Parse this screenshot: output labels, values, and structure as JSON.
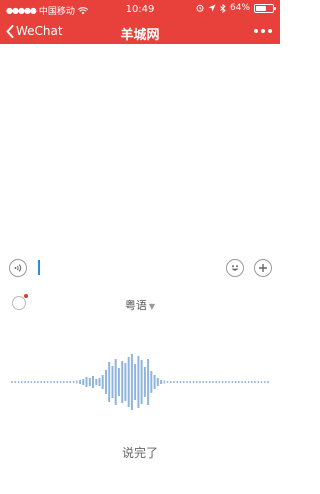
{
  "status_bar": {
    "carrier": "中国移动",
    "time": "10:49",
    "battery": "64%",
    "battery_level": 0.64
  },
  "nav": {
    "back_label": "WeChat",
    "title": "羊城网"
  },
  "voice": {
    "language": "粤语",
    "done_label": "说完了"
  },
  "colors": {
    "header": "#e8403a",
    "wave": "#8fb5dd",
    "cursor": "#2c8be0"
  }
}
